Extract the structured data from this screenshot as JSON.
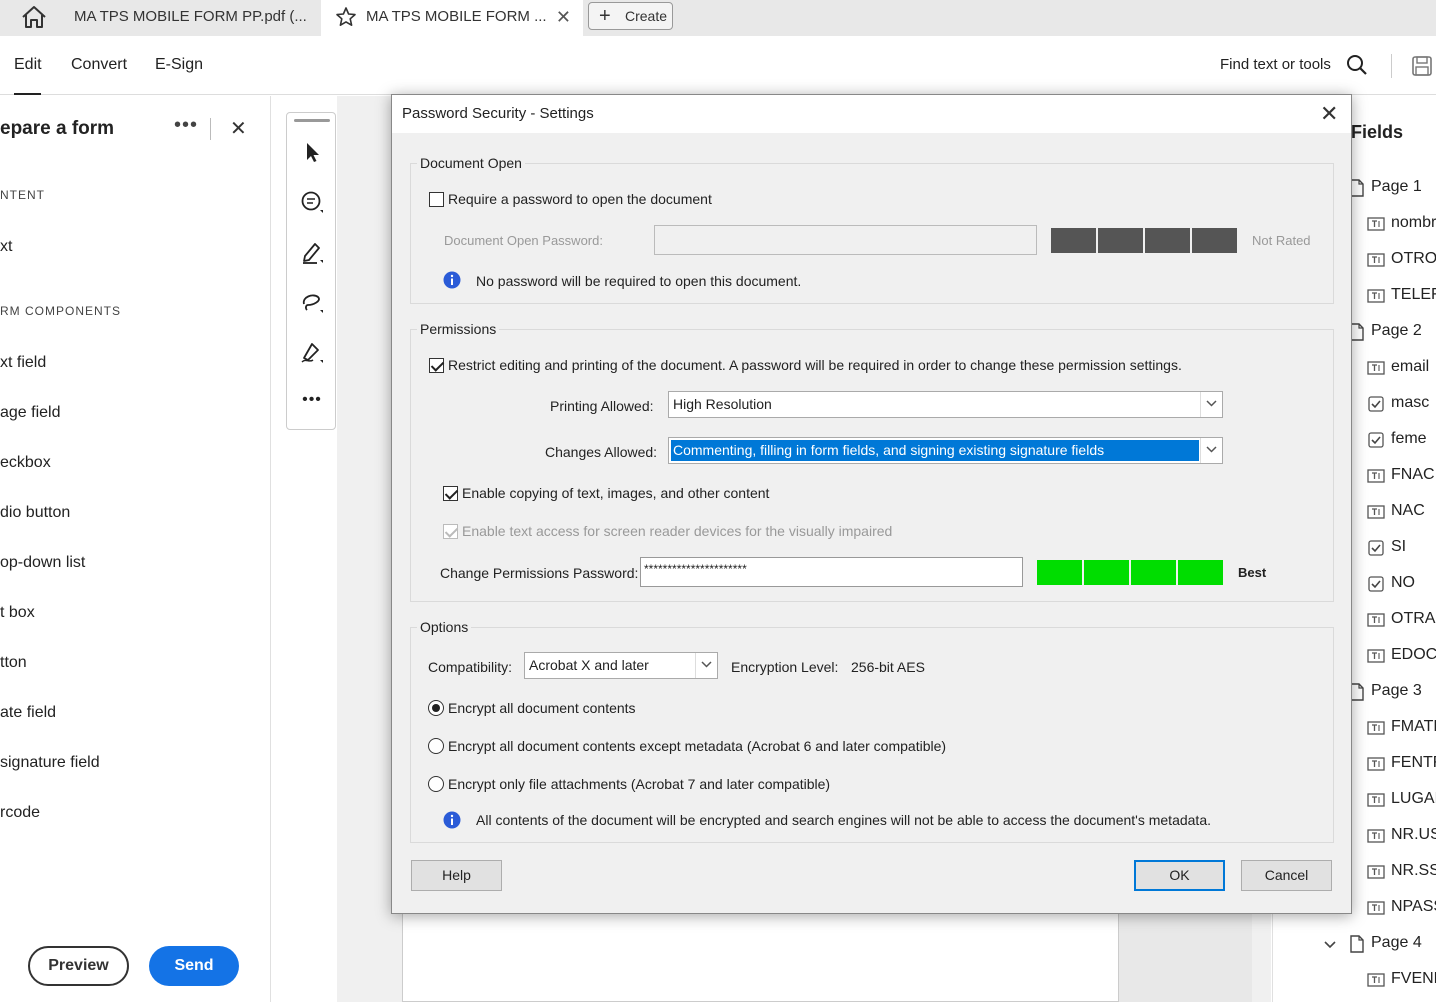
{
  "tabs": {
    "tab1_label": "MA TPS MOBILE FORM PP.pdf (...",
    "tab2_label": "MA TPS MOBILE FORM ...",
    "create_label": "Create"
  },
  "toolbar": {
    "edit": "Edit",
    "convert": "Convert",
    "esign": "E-Sign",
    "find": "Find text or tools"
  },
  "left_panel": {
    "title": "epare a form",
    "content_section": "NTENT",
    "text_item": "xt",
    "components_section": "RM COMPONENTS",
    "items": [
      "xt field",
      "age field",
      "eckbox",
      "dio button",
      "op-down list",
      "t box",
      "tton",
      "ate field",
      "signature field",
      "rcode"
    ],
    "preview": "Preview",
    "send": "Send"
  },
  "right_panel": {
    "title": "Fields",
    "rows": [
      {
        "label": "Page 1",
        "type": "page"
      },
      {
        "label": "nombr",
        "type": "text"
      },
      {
        "label": "OTRO",
        "type": "text"
      },
      {
        "label": "TELEF",
        "type": "text"
      },
      {
        "label": "Page 2",
        "type": "page"
      },
      {
        "label": "email",
        "type": "text"
      },
      {
        "label": "masc",
        "type": "check"
      },
      {
        "label": "feme",
        "type": "check"
      },
      {
        "label": "FNAC",
        "type": "text"
      },
      {
        "label": "NAC",
        "type": "text"
      },
      {
        "label": "SI",
        "type": "check"
      },
      {
        "label": "NO",
        "type": "check"
      },
      {
        "label": "OTRAN",
        "type": "text"
      },
      {
        "label": "EDOCI",
        "type": "text"
      },
      {
        "label": "Page 3",
        "type": "page"
      },
      {
        "label": "FMATR",
        "type": "text"
      },
      {
        "label": "FENTR",
        "type": "text"
      },
      {
        "label": "LUGAR",
        "type": "text"
      },
      {
        "label": "NR.USC",
        "type": "text"
      },
      {
        "label": "NR.SSN",
        "type": "text"
      },
      {
        "label": "NPASS",
        "type": "text"
      },
      {
        "label": "Page 4",
        "type": "page"
      },
      {
        "label": "FVENP",
        "type": "text"
      }
    ]
  },
  "dialog": {
    "title": "Password Security - Settings",
    "document_open": {
      "group_label": "Document Open",
      "require_password_label": "Require a password to open the document",
      "require_password_checked": false,
      "password_label": "Document Open Password:",
      "password_value": "",
      "strength_label": "Not Rated",
      "strength_color": "#555555",
      "info_text": "No password will be required to open this document."
    },
    "permissions": {
      "group_label": "Permissions",
      "restrict_label": "Restrict editing and printing of the document. A password will be required in order to change these permission settings.",
      "restrict_checked": true,
      "printing_label": "Printing Allowed:",
      "printing_value": "High Resolution",
      "changes_label": "Changes Allowed:",
      "changes_value": "Commenting, filling in form fields, and signing existing signature fields",
      "copy_label": "Enable copying of text, images, and other content",
      "copy_checked": true,
      "screen_reader_label": "Enable text access for screen reader devices for the visually impaired",
      "screen_reader_checked": true,
      "perm_password_label": "Change Permissions Password:",
      "perm_password_value": "**********************",
      "strength_label": "Best",
      "strength_color": "#00dd00"
    },
    "options": {
      "group_label": "Options",
      "compat_label": "Compatibility:",
      "compat_value": "Acrobat X and later",
      "encryption_label": "Encryption  Level:",
      "encryption_value": "256-bit AES",
      "radio1": "Encrypt all document contents",
      "radio2": "Encrypt all document contents except metadata (Acrobat 6 and later compatible)",
      "radio3": "Encrypt only file attachments (Acrobat 7 and later compatible)",
      "selected_radio": "radio1",
      "info_text": "All contents of the document will be encrypted and search engines will not be able to access the document's metadata."
    },
    "buttons": {
      "help": "Help",
      "ok": "OK",
      "cancel": "Cancel"
    }
  },
  "colors": {
    "accent": "#1473e6",
    "selection": "#0078d7",
    "info_icon": "#2a5bd7"
  }
}
